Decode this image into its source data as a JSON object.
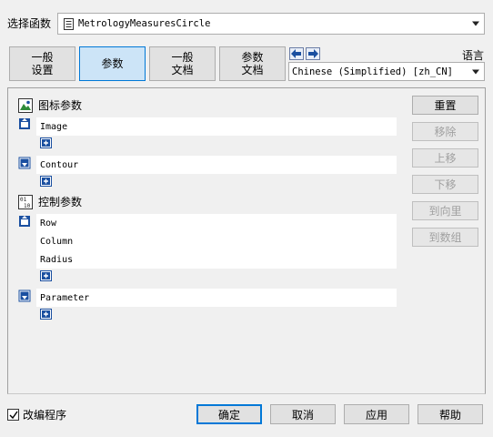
{
  "header": {
    "select_function_label": "选择函数",
    "function_value": "MetrologyMeasuresCircle",
    "language_label": "语言",
    "language_value": "Chinese (Simplified) [zh_CN]"
  },
  "tabs": [
    {
      "label": "一般\n设置",
      "active": false
    },
    {
      "label": "参数",
      "active": true
    },
    {
      "label": "一般\n文档",
      "active": false
    },
    {
      "label": "参数\n文档",
      "active": false
    }
  ],
  "sections": {
    "iconic_title": "图标参数",
    "control_title": "控制参数"
  },
  "iconic_params": [
    {
      "name": "Image"
    },
    {
      "name": "Contour"
    }
  ],
  "control_params": {
    "group1": [
      "Row",
      "Column",
      "Radius"
    ],
    "group2": [
      "Parameter"
    ]
  },
  "side_buttons": [
    {
      "label": "重置",
      "enabled": true
    },
    {
      "label": "移除",
      "enabled": false
    },
    {
      "label": "上移",
      "enabled": false
    },
    {
      "label": "下移",
      "enabled": false
    },
    {
      "label": "到向里",
      "enabled": false
    },
    {
      "label": "到数组",
      "enabled": false
    }
  ],
  "footer": {
    "modify_program_label": "改编程序",
    "modify_program_checked": true,
    "ok_label": "确定",
    "cancel_label": "取消",
    "apply_label": "应用",
    "help_label": "帮助"
  },
  "colors": {
    "active_tab": "#cce4f7",
    "accent": "#0078d7",
    "icon_blue": "#1a4fa0"
  },
  "icons": {
    "doc": "document-icon",
    "prev": "arrow-left-icon",
    "next": "arrow-right-icon",
    "iconic_section": "image-params-icon",
    "control_section": "control-params-icon",
    "input_param": "input-param-icon",
    "output_param": "output-param-icon",
    "add": "add-param-icon"
  }
}
